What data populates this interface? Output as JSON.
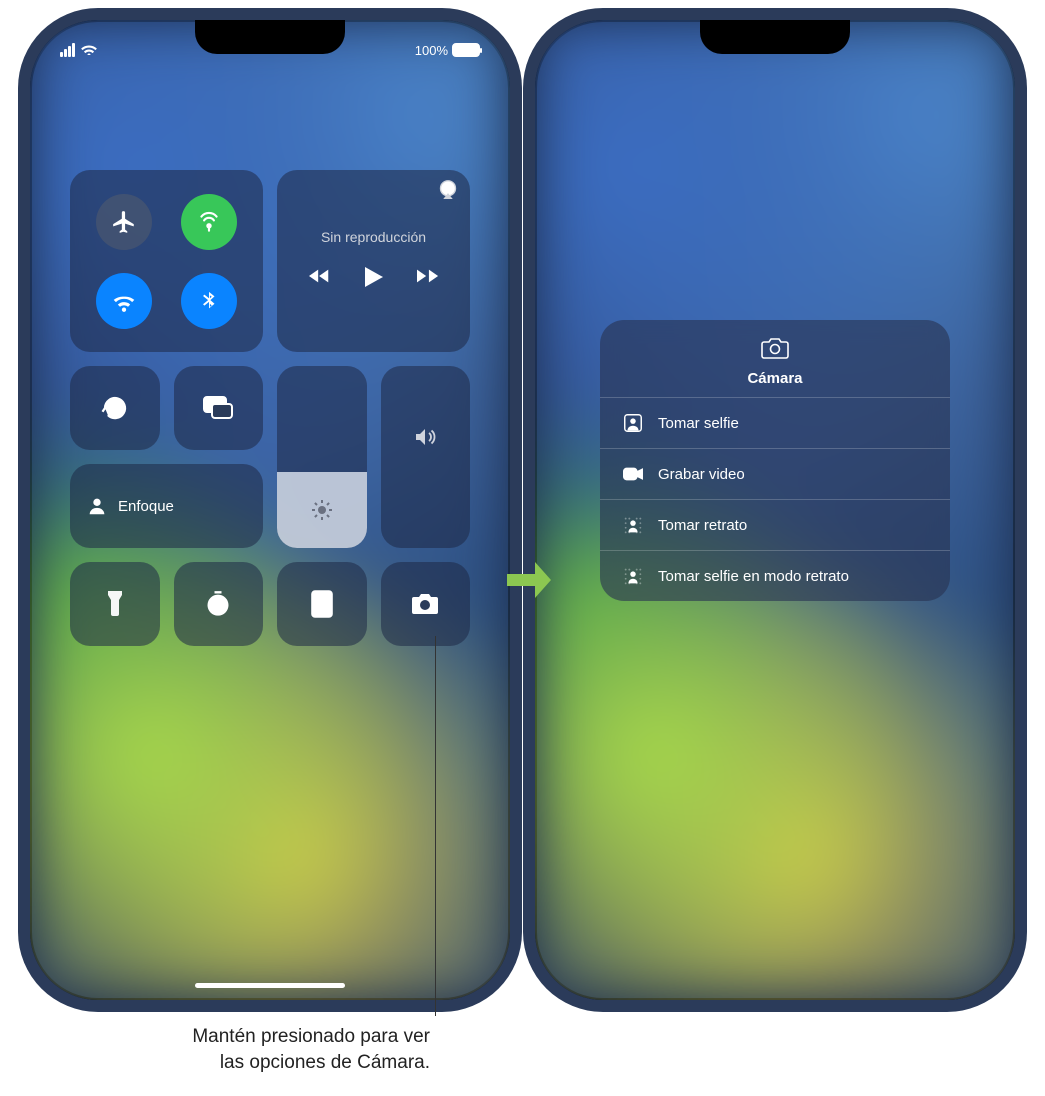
{
  "status": {
    "battery_pct": "100%"
  },
  "music": {
    "title": "Sin reproducción"
  },
  "focus": {
    "label": "Enfoque"
  },
  "sliders": {
    "brightness_pct": 42,
    "volume_pct": 0
  },
  "bottom_tiles": [
    "flashlight",
    "timer",
    "calculator",
    "camera"
  ],
  "camera_menu": {
    "title": "Cámara",
    "items": [
      {
        "key": "selfie",
        "label": "Tomar selfie"
      },
      {
        "key": "video",
        "label": "Grabar video"
      },
      {
        "key": "portrait",
        "label": "Tomar retrato"
      },
      {
        "key": "selfie_portrait",
        "label": "Tomar selfie en modo retrato"
      }
    ]
  },
  "callout": {
    "line1": "Mantén presionado para ver",
    "line2": "las opciones de Cámara."
  },
  "colors": {
    "green": "#38c759",
    "blue": "#0a84ff",
    "arrow": "#8cc751"
  }
}
